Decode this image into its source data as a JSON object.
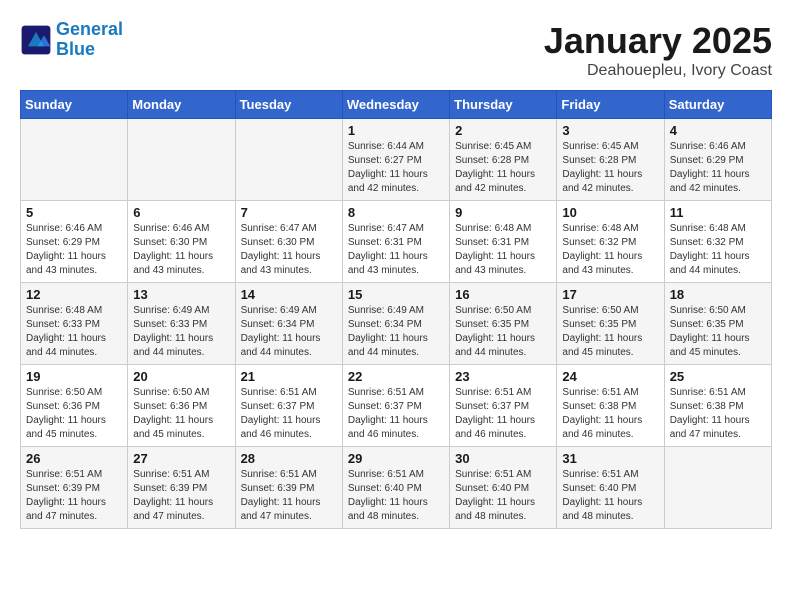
{
  "logo": {
    "line1": "General",
    "line2": "Blue"
  },
  "title": "January 2025",
  "subtitle": "Deahouepleu, Ivory Coast",
  "header_days": [
    "Sunday",
    "Monday",
    "Tuesday",
    "Wednesday",
    "Thursday",
    "Friday",
    "Saturday"
  ],
  "weeks": [
    [
      {
        "day": "",
        "sunrise": "",
        "sunset": "",
        "daylight": ""
      },
      {
        "day": "",
        "sunrise": "",
        "sunset": "",
        "daylight": ""
      },
      {
        "day": "",
        "sunrise": "",
        "sunset": "",
        "daylight": ""
      },
      {
        "day": "1",
        "sunrise": "Sunrise: 6:44 AM",
        "sunset": "Sunset: 6:27 PM",
        "daylight": "Daylight: 11 hours and 42 minutes."
      },
      {
        "day": "2",
        "sunrise": "Sunrise: 6:45 AM",
        "sunset": "Sunset: 6:28 PM",
        "daylight": "Daylight: 11 hours and 42 minutes."
      },
      {
        "day": "3",
        "sunrise": "Sunrise: 6:45 AM",
        "sunset": "Sunset: 6:28 PM",
        "daylight": "Daylight: 11 hours and 42 minutes."
      },
      {
        "day": "4",
        "sunrise": "Sunrise: 6:46 AM",
        "sunset": "Sunset: 6:29 PM",
        "daylight": "Daylight: 11 hours and 42 minutes."
      }
    ],
    [
      {
        "day": "5",
        "sunrise": "Sunrise: 6:46 AM",
        "sunset": "Sunset: 6:29 PM",
        "daylight": "Daylight: 11 hours and 43 minutes."
      },
      {
        "day": "6",
        "sunrise": "Sunrise: 6:46 AM",
        "sunset": "Sunset: 6:30 PM",
        "daylight": "Daylight: 11 hours and 43 minutes."
      },
      {
        "day": "7",
        "sunrise": "Sunrise: 6:47 AM",
        "sunset": "Sunset: 6:30 PM",
        "daylight": "Daylight: 11 hours and 43 minutes."
      },
      {
        "day": "8",
        "sunrise": "Sunrise: 6:47 AM",
        "sunset": "Sunset: 6:31 PM",
        "daylight": "Daylight: 11 hours and 43 minutes."
      },
      {
        "day": "9",
        "sunrise": "Sunrise: 6:48 AM",
        "sunset": "Sunset: 6:31 PM",
        "daylight": "Daylight: 11 hours and 43 minutes."
      },
      {
        "day": "10",
        "sunrise": "Sunrise: 6:48 AM",
        "sunset": "Sunset: 6:32 PM",
        "daylight": "Daylight: 11 hours and 43 minutes."
      },
      {
        "day": "11",
        "sunrise": "Sunrise: 6:48 AM",
        "sunset": "Sunset: 6:32 PM",
        "daylight": "Daylight: 11 hours and 44 minutes."
      }
    ],
    [
      {
        "day": "12",
        "sunrise": "Sunrise: 6:48 AM",
        "sunset": "Sunset: 6:33 PM",
        "daylight": "Daylight: 11 hours and 44 minutes."
      },
      {
        "day": "13",
        "sunrise": "Sunrise: 6:49 AM",
        "sunset": "Sunset: 6:33 PM",
        "daylight": "Daylight: 11 hours and 44 minutes."
      },
      {
        "day": "14",
        "sunrise": "Sunrise: 6:49 AM",
        "sunset": "Sunset: 6:34 PM",
        "daylight": "Daylight: 11 hours and 44 minutes."
      },
      {
        "day": "15",
        "sunrise": "Sunrise: 6:49 AM",
        "sunset": "Sunset: 6:34 PM",
        "daylight": "Daylight: 11 hours and 44 minutes."
      },
      {
        "day": "16",
        "sunrise": "Sunrise: 6:50 AM",
        "sunset": "Sunset: 6:35 PM",
        "daylight": "Daylight: 11 hours and 44 minutes."
      },
      {
        "day": "17",
        "sunrise": "Sunrise: 6:50 AM",
        "sunset": "Sunset: 6:35 PM",
        "daylight": "Daylight: 11 hours and 45 minutes."
      },
      {
        "day": "18",
        "sunrise": "Sunrise: 6:50 AM",
        "sunset": "Sunset: 6:35 PM",
        "daylight": "Daylight: 11 hours and 45 minutes."
      }
    ],
    [
      {
        "day": "19",
        "sunrise": "Sunrise: 6:50 AM",
        "sunset": "Sunset: 6:36 PM",
        "daylight": "Daylight: 11 hours and 45 minutes."
      },
      {
        "day": "20",
        "sunrise": "Sunrise: 6:50 AM",
        "sunset": "Sunset: 6:36 PM",
        "daylight": "Daylight: 11 hours and 45 minutes."
      },
      {
        "day": "21",
        "sunrise": "Sunrise: 6:51 AM",
        "sunset": "Sunset: 6:37 PM",
        "daylight": "Daylight: 11 hours and 46 minutes."
      },
      {
        "day": "22",
        "sunrise": "Sunrise: 6:51 AM",
        "sunset": "Sunset: 6:37 PM",
        "daylight": "Daylight: 11 hours and 46 minutes."
      },
      {
        "day": "23",
        "sunrise": "Sunrise: 6:51 AM",
        "sunset": "Sunset: 6:37 PM",
        "daylight": "Daylight: 11 hours and 46 minutes."
      },
      {
        "day": "24",
        "sunrise": "Sunrise: 6:51 AM",
        "sunset": "Sunset: 6:38 PM",
        "daylight": "Daylight: 11 hours and 46 minutes."
      },
      {
        "day": "25",
        "sunrise": "Sunrise: 6:51 AM",
        "sunset": "Sunset: 6:38 PM",
        "daylight": "Daylight: 11 hours and 47 minutes."
      }
    ],
    [
      {
        "day": "26",
        "sunrise": "Sunrise: 6:51 AM",
        "sunset": "Sunset: 6:39 PM",
        "daylight": "Daylight: 11 hours and 47 minutes."
      },
      {
        "day": "27",
        "sunrise": "Sunrise: 6:51 AM",
        "sunset": "Sunset: 6:39 PM",
        "daylight": "Daylight: 11 hours and 47 minutes."
      },
      {
        "day": "28",
        "sunrise": "Sunrise: 6:51 AM",
        "sunset": "Sunset: 6:39 PM",
        "daylight": "Daylight: 11 hours and 47 minutes."
      },
      {
        "day": "29",
        "sunrise": "Sunrise: 6:51 AM",
        "sunset": "Sunset: 6:40 PM",
        "daylight": "Daylight: 11 hours and 48 minutes."
      },
      {
        "day": "30",
        "sunrise": "Sunrise: 6:51 AM",
        "sunset": "Sunset: 6:40 PM",
        "daylight": "Daylight: 11 hours and 48 minutes."
      },
      {
        "day": "31",
        "sunrise": "Sunrise: 6:51 AM",
        "sunset": "Sunset: 6:40 PM",
        "daylight": "Daylight: 11 hours and 48 minutes."
      },
      {
        "day": "",
        "sunrise": "",
        "sunset": "",
        "daylight": ""
      }
    ]
  ]
}
